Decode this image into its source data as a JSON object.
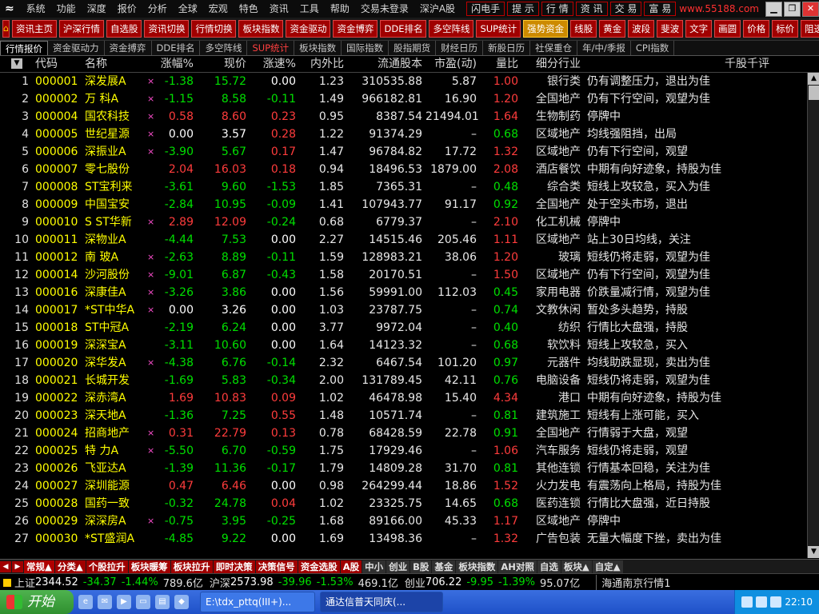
{
  "menu": {
    "items": [
      "系统",
      "功能",
      "深度",
      "报价",
      "分析",
      "全球",
      "宏观",
      "特色",
      "资讯",
      "工具",
      "帮助",
      "交易未登录",
      "深沪A股"
    ],
    "buttons": [
      "闪电手",
      "提 示",
      "行 情",
      "资 讯",
      "交 易",
      "富 易"
    ],
    "url_text": "www.55188.com"
  },
  "toolbar": {
    "buttons": [
      "资讯主页",
      "沪深行情",
      "自选股",
      "资讯切换",
      "行情切换",
      "板块指数",
      "资金驱动",
      "资金博弈",
      "DDE排名",
      "多空阵线",
      "SUP统计",
      "强势资金",
      "线股",
      "黄金",
      "波段",
      "斐波",
      "文字",
      "画圆",
      "价格",
      "标价",
      "阻透"
    ]
  },
  "tabs": [
    "行情报价",
    "资金驱动力",
    "资金搏弈",
    "DDE排名",
    "多空阵线",
    "SUP统计",
    "板块指数",
    "国际指数",
    "股指期货",
    "财经日历",
    "新股日历",
    "社保重仓",
    "年/中/季报",
    "CPI指数"
  ],
  "header": {
    "idx": "",
    "code": "代码",
    "name": "名称",
    "pct": "涨幅%",
    "price": "现价",
    "speed": "涨速%",
    "inout": "内外比",
    "float": "流通股本",
    "pe": "市盈(动)",
    "vr": "量比",
    "industry": "细分行业",
    "comment": "千股千评"
  },
  "rows": [
    {
      "i": "1",
      "code": "000001",
      "name": "深发展A",
      "mark": "×",
      "pct": "-1.38",
      "price": "15.72",
      "speed": "0.00",
      "io": "1.23",
      "fl": "310535.88",
      "pe": "5.87",
      "vr": "1.00",
      "ind": "银行类",
      "cm": "仍有调整压力，退出为佳"
    },
    {
      "i": "2",
      "code": "000002",
      "name": "万 科A",
      "mark": "×",
      "pct": "-1.15",
      "price": "8.58",
      "speed": "-0.11",
      "io": "1.49",
      "fl": "966182.81",
      "pe": "16.90",
      "vr": "1.20",
      "ind": "全国地产",
      "cm": "仍有下行空间，观望为佳"
    },
    {
      "i": "3",
      "code": "000004",
      "name": "国农科技",
      "mark": "×",
      "pct": "0.58",
      "price": "8.60",
      "speed": "0.23",
      "io": "0.95",
      "fl": "8387.54",
      "pe": "21494.01",
      "vr": "1.64",
      "ind": "生物制药",
      "cm": "停牌中"
    },
    {
      "i": "4",
      "code": "000005",
      "name": "世纪星源",
      "mark": "×",
      "pct": "0.00",
      "price": "3.57",
      "speed": "0.28",
      "io": "1.22",
      "fl": "91374.29",
      "pe": "–",
      "vr": "0.68",
      "ind": "区域地产",
      "cm": "均线强阻挡，出局"
    },
    {
      "i": "5",
      "code": "000006",
      "name": "深振业A",
      "mark": "×",
      "pct": "-3.90",
      "price": "5.67",
      "speed": "0.17",
      "io": "1.47",
      "fl": "96784.82",
      "pe": "17.72",
      "vr": "1.32",
      "ind": "区域地产",
      "cm": "仍有下行空间，观望"
    },
    {
      "i": "6",
      "code": "000007",
      "name": "零七股份",
      "mark": "",
      "pct": "2.04",
      "price": "16.03",
      "speed": "0.18",
      "io": "0.94",
      "fl": "18496.53",
      "pe": "1879.00",
      "vr": "2.08",
      "ind": "酒店餐饮",
      "cm": "中期有向好迹象，持股为佳"
    },
    {
      "i": "7",
      "code": "000008",
      "name": "ST宝利来",
      "mark": "",
      "pct": "-3.61",
      "price": "9.60",
      "speed": "-1.53",
      "io": "1.85",
      "fl": "7365.31",
      "pe": "–",
      "vr": "0.48",
      "ind": "综合类",
      "cm": "短线上攻较急，买入为佳"
    },
    {
      "i": "8",
      "code": "000009",
      "name": "中国宝安",
      "mark": "",
      "pct": "-2.84",
      "price": "10.95",
      "speed": "-0.09",
      "io": "1.41",
      "fl": "107943.77",
      "pe": "91.17",
      "vr": "0.92",
      "ind": "全国地产",
      "cm": "处于空头市场，退出"
    },
    {
      "i": "9",
      "code": "000010",
      "name": "S ST华新",
      "mark": "×",
      "pct": "2.89",
      "price": "12.09",
      "speed": "-0.24",
      "io": "0.68",
      "fl": "6779.37",
      "pe": "–",
      "vr": "2.10",
      "ind": "化工机械",
      "cm": "停牌中"
    },
    {
      "i": "10",
      "code": "000011",
      "name": "深物业A",
      "mark": "",
      "pct": "-4.44",
      "price": "7.53",
      "speed": "0.00",
      "io": "2.27",
      "fl": "14515.46",
      "pe": "205.46",
      "vr": "1.11",
      "ind": "区域地产",
      "cm": "站上30日均线，关注"
    },
    {
      "i": "11",
      "code": "000012",
      "name": "南 玻A",
      "mark": "×",
      "pct": "-2.63",
      "price": "8.89",
      "speed": "-0.11",
      "io": "1.59",
      "fl": "128983.21",
      "pe": "38.06",
      "vr": "1.20",
      "ind": "玻璃",
      "cm": "短线仍将走弱，观望为佳"
    },
    {
      "i": "12",
      "code": "000014",
      "name": "沙河股份",
      "mark": "×",
      "pct": "-9.01",
      "price": "6.87",
      "speed": "-0.43",
      "io": "1.58",
      "fl": "20170.51",
      "pe": "–",
      "vr": "1.50",
      "ind": "区域地产",
      "cm": "仍有下行空间，观望为佳"
    },
    {
      "i": "13",
      "code": "000016",
      "name": "深康佳A",
      "mark": "×",
      "pct": "-3.26",
      "price": "3.86",
      "speed": "0.00",
      "io": "1.56",
      "fl": "59991.00",
      "pe": "112.03",
      "vr": "0.45",
      "ind": "家用电器",
      "cm": "价跌量减行情，观望为佳"
    },
    {
      "i": "14",
      "code": "000017",
      "name": "*ST中华A",
      "mark": "×",
      "pct": "0.00",
      "price": "3.26",
      "speed": "0.00",
      "io": "1.03",
      "fl": "23787.75",
      "pe": "–",
      "vr": "0.74",
      "ind": "文教休闲",
      "cm": "暂处多头趋势，持股"
    },
    {
      "i": "15",
      "code": "000018",
      "name": "ST中冠A",
      "mark": "",
      "pct": "-2.19",
      "price": "6.24",
      "speed": "0.00",
      "io": "3.77",
      "fl": "9972.04",
      "pe": "–",
      "vr": "0.40",
      "ind": "纺织",
      "cm": "行情比大盘强，持股"
    },
    {
      "i": "16",
      "code": "000019",
      "name": "深深宝A",
      "mark": "",
      "pct": "-3.11",
      "price": "10.60",
      "speed": "0.00",
      "io": "1.64",
      "fl": "14123.32",
      "pe": "–",
      "vr": "0.68",
      "ind": "软饮料",
      "cm": "短线上攻较急，买入"
    },
    {
      "i": "17",
      "code": "000020",
      "name": "深华发A",
      "mark": "×",
      "pct": "-4.38",
      "price": "6.76",
      "speed": "-0.14",
      "io": "2.32",
      "fl": "6467.54",
      "pe": "101.20",
      "vr": "0.97",
      "ind": "元器件",
      "cm": "均线助跌显现，卖出为佳"
    },
    {
      "i": "18",
      "code": "000021",
      "name": "长城开发",
      "mark": "",
      "pct": "-1.69",
      "price": "5.83",
      "speed": "-0.34",
      "io": "2.00",
      "fl": "131789.45",
      "pe": "42.11",
      "vr": "0.76",
      "ind": "电脑设备",
      "cm": "短线仍将走弱，观望为佳"
    },
    {
      "i": "19",
      "code": "000022",
      "name": "深赤湾A",
      "mark": "",
      "pct": "1.69",
      "price": "10.83",
      "speed": "0.09",
      "io": "1.02",
      "fl": "46478.98",
      "pe": "15.40",
      "vr": "4.34",
      "ind": "港口",
      "cm": "中期有向好迹象，持股为佳"
    },
    {
      "i": "20",
      "code": "000023",
      "name": "深天地A",
      "mark": "",
      "pct": "-1.36",
      "price": "7.25",
      "speed": "0.55",
      "io": "1.48",
      "fl": "10571.74",
      "pe": "–",
      "vr": "0.81",
      "ind": "建筑施工",
      "cm": "短线有上涨可能，买入"
    },
    {
      "i": "21",
      "code": "000024",
      "name": "招商地产",
      "mark": "×",
      "pct": "0.31",
      "price": "22.79",
      "speed": "0.13",
      "io": "0.78",
      "fl": "68428.59",
      "pe": "22.78",
      "vr": "0.91",
      "ind": "全国地产",
      "cm": "行情弱于大盘，观望"
    },
    {
      "i": "22",
      "code": "000025",
      "name": "特 力A",
      "mark": "×",
      "pct": "-5.50",
      "price": "6.70",
      "speed": "-0.59",
      "io": "1.75",
      "fl": "17929.46",
      "pe": "–",
      "vr": "1.06",
      "ind": "汽车服务",
      "cm": "短线仍将走弱，观望"
    },
    {
      "i": "23",
      "code": "000026",
      "name": "飞亚达A",
      "mark": "",
      "pct": "-1.39",
      "price": "11.36",
      "speed": "-0.17",
      "io": "1.79",
      "fl": "14809.28",
      "pe": "31.70",
      "vr": "0.81",
      "ind": "其他连锁",
      "cm": "行情基本回稳，关注为佳"
    },
    {
      "i": "24",
      "code": "000027",
      "name": "深圳能源",
      "mark": "",
      "pct": "0.47",
      "price": "6.46",
      "speed": "0.00",
      "io": "0.98",
      "fl": "264299.44",
      "pe": "18.86",
      "vr": "1.52",
      "ind": "火力发电",
      "cm": "有震荡向上格局，持股为佳"
    },
    {
      "i": "25",
      "code": "000028",
      "name": "国药一致",
      "mark": "",
      "pct": "-0.32",
      "price": "24.78",
      "speed": "0.04",
      "io": "1.02",
      "fl": "23325.75",
      "pe": "14.65",
      "vr": "0.68",
      "ind": "医药连锁",
      "cm": "行情比大盘强，近日持股"
    },
    {
      "i": "26",
      "code": "000029",
      "name": "深深房A",
      "mark": "×",
      "pct": "-0.75",
      "price": "3.95",
      "speed": "-0.25",
      "io": "1.68",
      "fl": "89166.00",
      "pe": "45.33",
      "vr": "1.17",
      "ind": "区域地产",
      "cm": "停牌中"
    },
    {
      "i": "27",
      "code": "000030",
      "name": "*ST盛润A",
      "mark": "",
      "pct": "-4.85",
      "price": "9.22",
      "speed": "0.00",
      "io": "1.69",
      "fl": "13498.36",
      "pe": "–",
      "vr": "1.32",
      "ind": "广告包装",
      "cm": "无量大幅度下挫，卖出为佳"
    }
  ],
  "bottom_tabs": [
    "常规▲",
    "分类▲",
    "个股拉升",
    "板块暖筹",
    "板块拉升",
    "即时决策",
    "决策信号",
    "资金选股",
    "A股",
    "中小",
    "创业",
    "B股",
    "基金",
    "板块指数",
    "AH对照",
    "自选",
    "板块▲",
    "自定▲"
  ],
  "index_bar": {
    "sh_label": "上证",
    "sh_value": "2344.52",
    "sh_change": "-34.37",
    "sh_pct": "-1.44%",
    "sh_amount": "789.6亿",
    "sz_label": "沪深",
    "sz_value": "2573.98",
    "sz_change": "-39.96",
    "sz_pct": "-1.53%",
    "sz_amount": "469.1亿",
    "cy_label": "创业",
    "cy_value": "706.22",
    "cy_change": "-9.95",
    "cy_pct": "-1.39%",
    "cy_amount": "95.07亿",
    "provider": "海通南京行情1"
  },
  "taskbar": {
    "start": "开始",
    "tasks": [
      "E:\\tdx_pttq(III+)...",
      "通达信普天同庆(..."
    ],
    "time": "22:10"
  },
  "colors": {
    "up": "#ff3c3c",
    "down": "#00e000",
    "code": "#ffff00",
    "accent": "#a00000"
  }
}
